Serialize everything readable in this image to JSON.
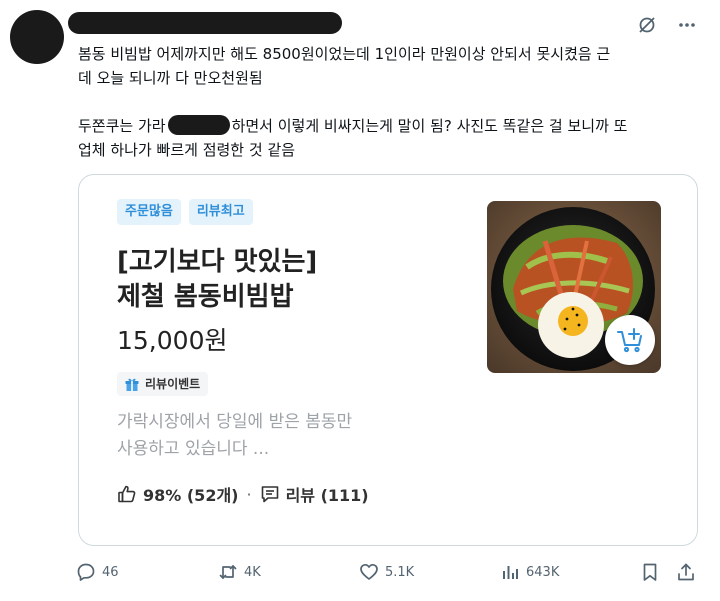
{
  "tweet": {
    "text_lines": [
      "봄동 비빔밥 어제까지만 해도 8500원이었는데 1인이라 만원이상 안되서 못시켰음 근",
      "데 오늘 되니까 다 만오천원됨"
    ],
    "text2_before": "두쫀쿠는 가라",
    "text2_after": "하면서 이렇게 비싸지는게 말이 됨? 사진도 똑같은 걸 보니까 또",
    "text3": "업체 하나가 빠르게 점령한 것 같음"
  },
  "card": {
    "badges": [
      "주문많음",
      "리뷰최고"
    ],
    "title_line1": "[고기보다 맛있는]",
    "title_line2": "제철 봄동비빔밥",
    "price": "15,000원",
    "event_label": "리뷰이벤트",
    "desc_line1": "가락시장에서 당일에 받은 봄동만",
    "desc_line2": "사용하고 있습니다 ...",
    "like_stat": "98% (52개)",
    "dot": "·",
    "review_label": "리뷰 (111)"
  },
  "actions": {
    "replies": "46",
    "reposts": "4K",
    "likes": "5.1K",
    "views": "643K"
  },
  "colors": {
    "badge_bg": "#e4f2fc",
    "badge_text": "#2f8fd8",
    "secondary_text": "#536471",
    "card_border": "#cfd9de"
  },
  "icons": [
    "grok-icon",
    "more-icon",
    "gift-icon",
    "thumbs-up-icon",
    "review-icon",
    "cart-add-icon",
    "reply-icon",
    "repost-icon",
    "like-icon",
    "views-icon",
    "bookmark-icon",
    "share-icon"
  ]
}
